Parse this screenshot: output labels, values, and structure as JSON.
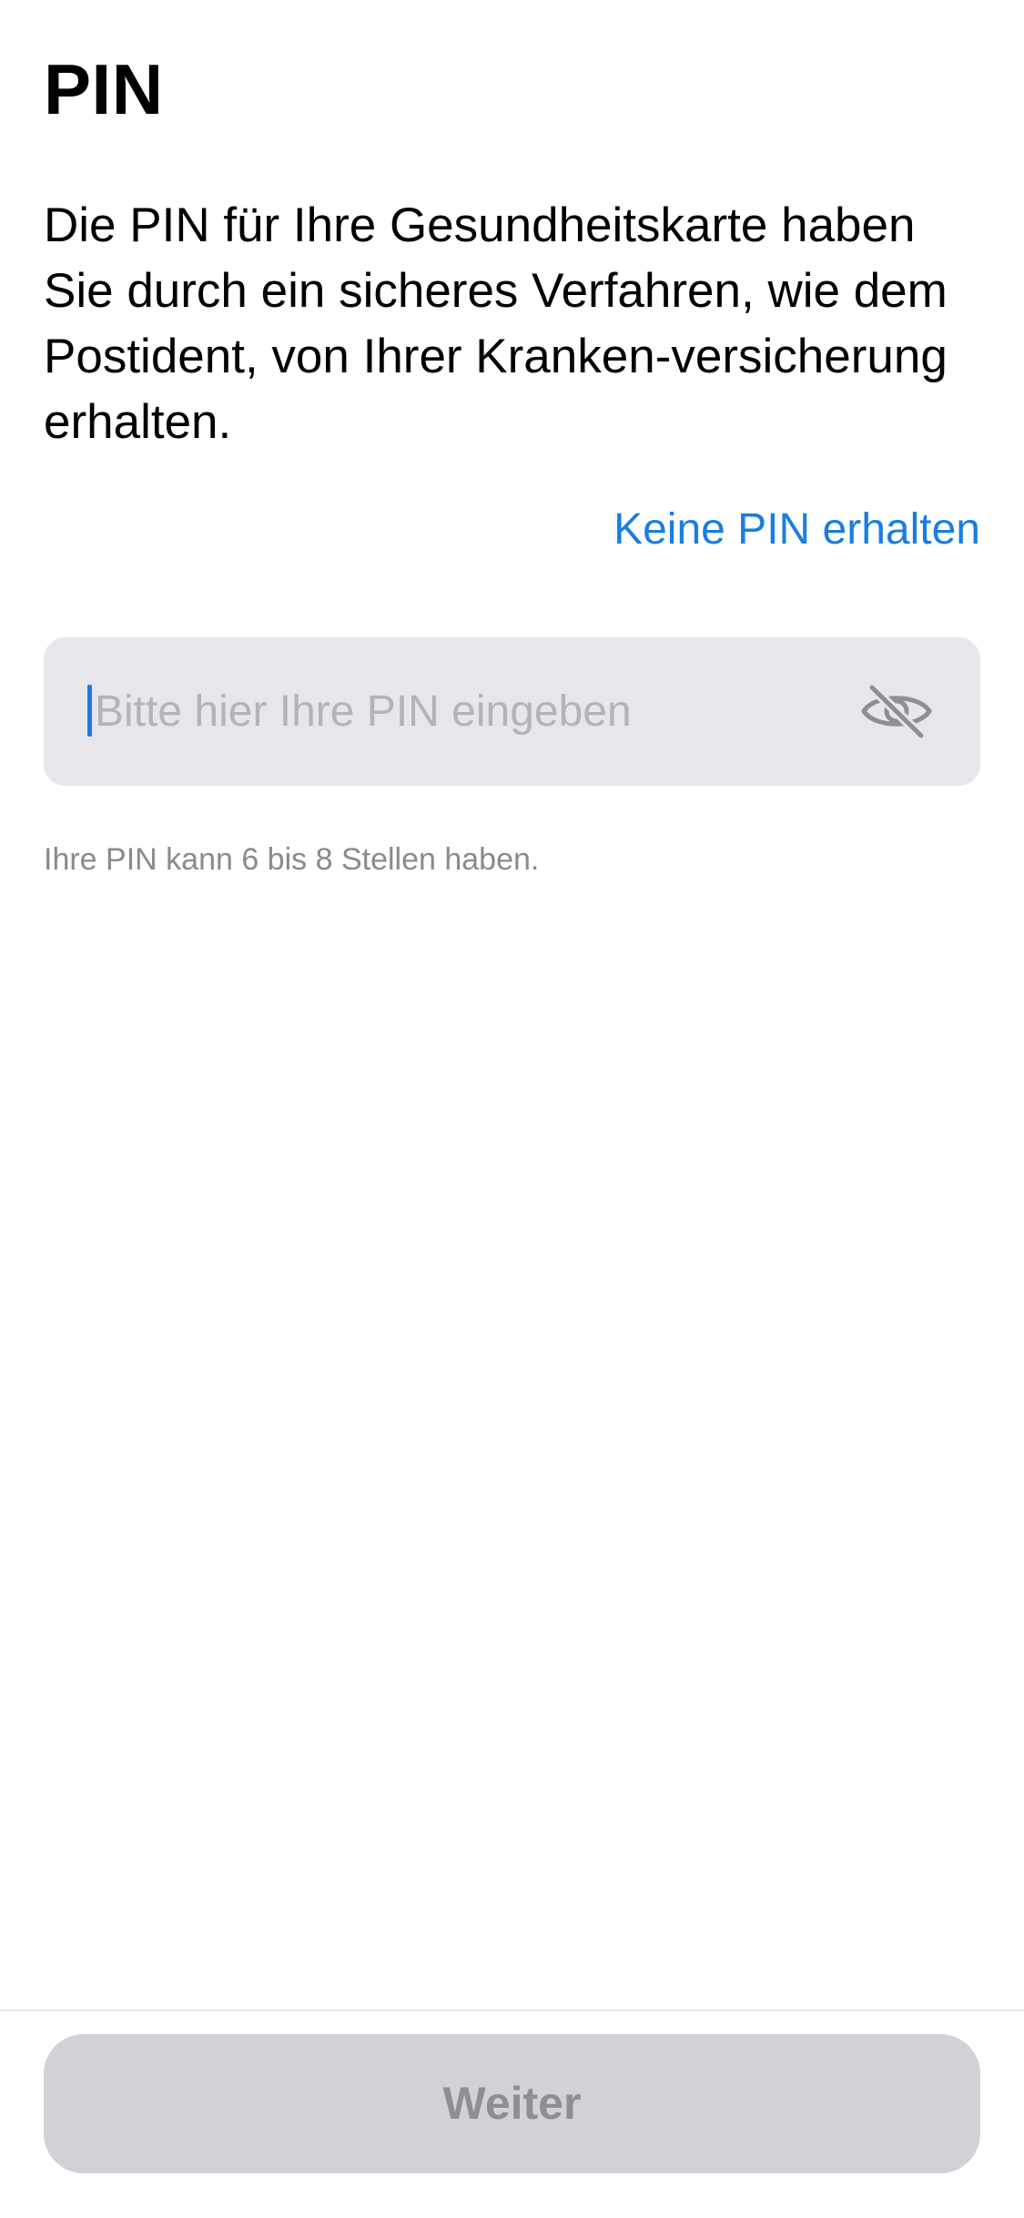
{
  "header": {
    "title": "PIN"
  },
  "intro": {
    "text": "Die PIN für Ihre Gesundheitskarte haben Sie durch ein sicheres Verfahren, wie dem Postident, von Ihrer Kranken-versicherung erhalten."
  },
  "help_link": {
    "label": "Keine PIN erhalten"
  },
  "pin_field": {
    "placeholder": "Bitte hier Ihre PIN eingeben",
    "value": "",
    "visibility_icon": "eye-slash-icon"
  },
  "hint": {
    "text": "Ihre PIN kann 6 bis 8 Stellen haben."
  },
  "footer": {
    "next_label": "Weiter",
    "next_enabled": false
  },
  "colors": {
    "accent": "#1a7ee0",
    "field_background": "#e6e6eb",
    "button_disabled_background": "#d1d1d6",
    "button_disabled_text": "#8e8e93",
    "hint_text": "#8a8a8e"
  }
}
